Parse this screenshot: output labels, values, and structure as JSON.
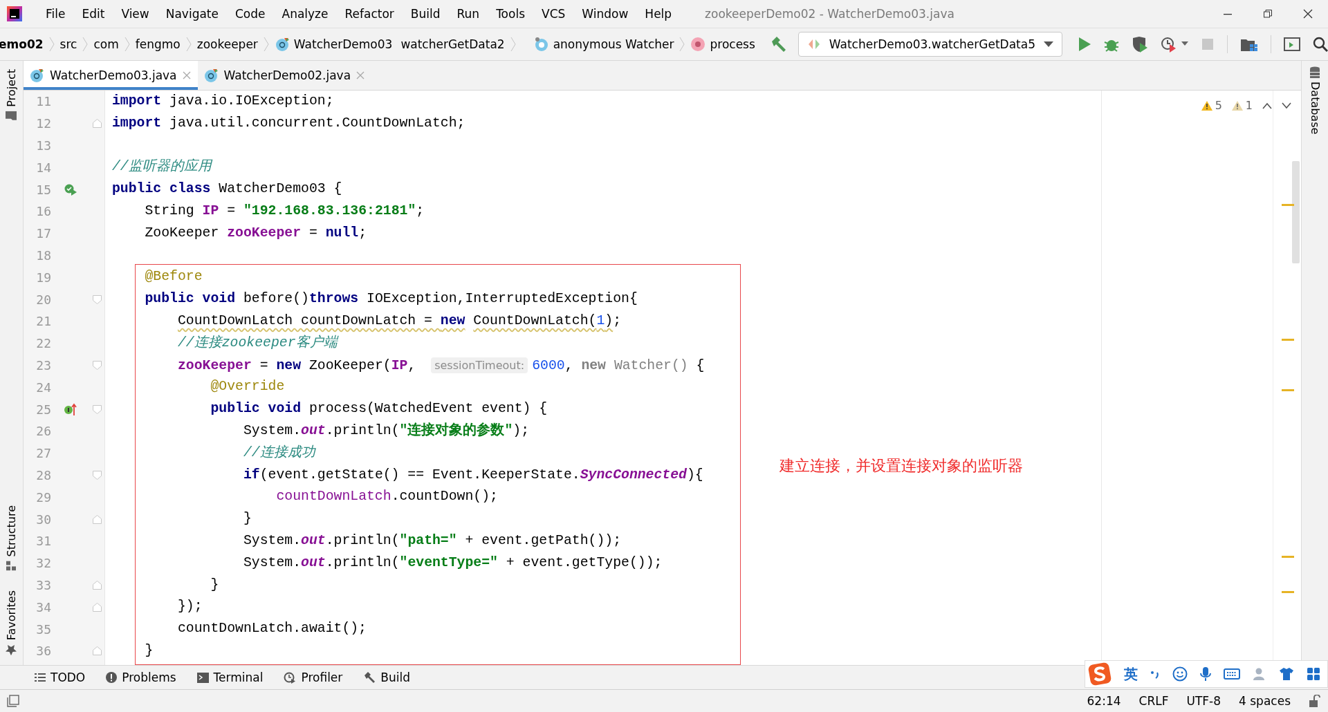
{
  "window": {
    "title": "zookeeperDemo02 - WatcherDemo03.java"
  },
  "menu": [
    "File",
    "Edit",
    "View",
    "Navigate",
    "Code",
    "Analyze",
    "Refactor",
    "Build",
    "Run",
    "Tools",
    "VCS",
    "Window",
    "Help"
  ],
  "breadcrumbs": [
    {
      "kind": "project",
      "label": "emo02"
    },
    {
      "kind": "folder",
      "label": "src"
    },
    {
      "kind": "folder",
      "label": "com"
    },
    {
      "kind": "folder",
      "label": "fengmo"
    },
    {
      "kind": "folder",
      "label": "zookeeper"
    },
    {
      "kind": "class",
      "label": "WatcherDemo03"
    },
    {
      "kind": "plain",
      "label": "watcherGetData2"
    },
    {
      "kind": "anonymous",
      "label": "anonymous Watcher"
    },
    {
      "kind": "method",
      "label": "process"
    }
  ],
  "run_config": {
    "label": "WatcherDemo03.watcherGetData5"
  },
  "tabs": [
    {
      "label": "WatcherDemo03.java",
      "selected": true
    },
    {
      "label": "WatcherDemo02.java",
      "selected": false
    }
  ],
  "side_tabs_left": [
    {
      "label": "Project",
      "kind": "project"
    },
    {
      "label": "Structure",
      "kind": "structure"
    },
    {
      "label": "Favorites",
      "kind": "favorites"
    }
  ],
  "side_tabs_right": [
    {
      "label": "Database"
    }
  ],
  "inspections": [
    {
      "kind": "warning",
      "count": "5"
    },
    {
      "kind": "weak",
      "count": "1"
    }
  ],
  "code_lines": [
    {
      "number": "11",
      "tokens": [
        {
          "kind": "kw",
          "text": "import"
        },
        {
          "kind": "plain",
          "text": " java.io.IOException;"
        }
      ]
    },
    {
      "number": "12",
      "fold": {
        "kind": "end"
      },
      "tokens": [
        {
          "kind": "kw",
          "text": "import"
        },
        {
          "kind": "plain",
          "text": " java.util.concurrent.CountDownLatch;"
        }
      ]
    },
    {
      "number": "13"
    },
    {
      "number": "14",
      "tokens": [
        {
          "kind": "comment",
          "text": "//监听器的应用"
        }
      ]
    },
    {
      "number": "15",
      "gutter_icon": {
        "kind": "run"
      },
      "tokens": [
        {
          "kind": "kw",
          "text": "public class"
        },
        {
          "kind": "plain",
          "text": " WatcherDemo03 {"
        }
      ]
    },
    {
      "number": "16",
      "tokens": [
        {
          "kind": "plain",
          "text": "    String "
        },
        {
          "kind": "field",
          "text": "IP"
        },
        {
          "kind": "plain",
          "text": " = "
        },
        {
          "kind": "str",
          "text": "\"192.168.83.136:2181\""
        },
        {
          "kind": "plain",
          "text": ";"
        }
      ]
    },
    {
      "number": "17",
      "tokens": [
        {
          "kind": "plain",
          "text": "    ZooKeeper "
        },
        {
          "kind": "field",
          "text": "zooKeeper"
        },
        {
          "kind": "plain",
          "text": " = "
        },
        {
          "kind": "kw",
          "text": "null"
        },
        {
          "kind": "plain",
          "text": ";"
        }
      ]
    },
    {
      "number": "18"
    },
    {
      "number": "19",
      "tokens": [
        {
          "kind": "annotation",
          "text": "    @Before"
        }
      ]
    },
    {
      "number": "20",
      "fold": {
        "kind": "start"
      },
      "tokens": [
        {
          "kind": "kw",
          "text": "    public void"
        },
        {
          "kind": "plain",
          "text": " before()"
        },
        {
          "kind": "kw",
          "text": "throws"
        },
        {
          "kind": "plain",
          "text": " IOException,InterruptedException{"
        }
      ]
    },
    {
      "number": "21",
      "tokens": [
        {
          "kind": "warn",
          "text": "        CountDownLatch countDownLatch = "
        },
        {
          "kind": "kwwarn",
          "text": "new"
        },
        {
          "kind": "warn",
          "text": " CountDownLatch("
        },
        {
          "kind": "numwarn",
          "text": "1"
        },
        {
          "kind": "warn",
          "text": ")"
        },
        {
          "kind": "plain",
          "text": ";"
        }
      ]
    },
    {
      "number": "22",
      "tokens": [
        {
          "kind": "comment",
          "text": "        //连接zookeeper客户端"
        }
      ]
    },
    {
      "number": "23",
      "fold": {
        "kind": "start"
      },
      "tokens": [
        {
          "kind": "field",
          "text": "        zooKeeper"
        },
        {
          "kind": "plain",
          "text": " = "
        },
        {
          "kind": "kw",
          "text": "new"
        },
        {
          "kind": "plain",
          "text": " ZooKeeper("
        },
        {
          "kind": "field",
          "text": "IP"
        },
        {
          "kind": "plain",
          "text": ", "
        },
        {
          "kind": "hint",
          "text": "sessionTimeout:"
        },
        {
          "kind": "num",
          "text": "6000"
        },
        {
          "kind": "plain",
          "text": ", "
        },
        {
          "kind": "dimkw",
          "text": "new"
        },
        {
          "kind": "dim",
          "text": " Watcher()"
        },
        {
          "kind": "plain",
          "text": " {"
        }
      ]
    },
    {
      "number": "24",
      "tokens": [
        {
          "kind": "annotation",
          "text": "            @Override"
        }
      ]
    },
    {
      "number": "25",
      "gutter_icon": {
        "kind": "implements"
      },
      "fold": {
        "kind": "start"
      },
      "tokens": [
        {
          "kind": "kw",
          "text": "            public void"
        },
        {
          "kind": "plain",
          "text": " process(WatchedEvent event) {"
        }
      ]
    },
    {
      "number": "26",
      "tokens": [
        {
          "kind": "plain",
          "text": "                System."
        },
        {
          "kind": "static",
          "text": "out"
        },
        {
          "kind": "plain",
          "text": ".println("
        },
        {
          "kind": "str",
          "text": "\"连接对象的参数\""
        },
        {
          "kind": "plain",
          "text": ");"
        }
      ]
    },
    {
      "number": "27",
      "tokens": [
        {
          "kind": "comment",
          "text": "                //连接成功"
        }
      ]
    },
    {
      "number": "28",
      "fold": {
        "kind": "start"
      },
      "tokens": [
        {
          "kind": "kw",
          "text": "                if"
        },
        {
          "kind": "plain",
          "text": "(event.getState() == Event.KeeperState."
        },
        {
          "kind": "static",
          "text": "SyncConnected"
        },
        {
          "kind": "plain",
          "text": "){"
        }
      ]
    },
    {
      "number": "29",
      "tokens": [
        {
          "kind": "fieldplain",
          "text": "                    countDownLatch"
        },
        {
          "kind": "plain",
          "text": ".countDown();"
        }
      ]
    },
    {
      "number": "30",
      "fold": {
        "kind": "end"
      },
      "tokens": [
        {
          "kind": "plain",
          "text": "                }"
        }
      ]
    },
    {
      "number": "31",
      "tokens": [
        {
          "kind": "plain",
          "text": "                System."
        },
        {
          "kind": "static",
          "text": "out"
        },
        {
          "kind": "plain",
          "text": ".println("
        },
        {
          "kind": "str",
          "text": "\"path=\""
        },
        {
          "kind": "plain",
          "text": " + event.getPath());"
        }
      ]
    },
    {
      "number": "32",
      "tokens": [
        {
          "kind": "plain",
          "text": "                System."
        },
        {
          "kind": "static",
          "text": "out"
        },
        {
          "kind": "plain",
          "text": ".println("
        },
        {
          "kind": "str",
          "text": "\"eventType=\""
        },
        {
          "kind": "plain",
          "text": " + event.getType());"
        }
      ]
    },
    {
      "number": "33",
      "fold": {
        "kind": "end"
      },
      "tokens": [
        {
          "kind": "plain",
          "text": "            }"
        }
      ]
    },
    {
      "number": "34",
      "fold": {
        "kind": "end"
      },
      "tokens": [
        {
          "kind": "plain",
          "text": "        });"
        }
      ]
    },
    {
      "number": "35",
      "tokens": [
        {
          "kind": "plain",
          "text": "        countDownLatch.await();"
        }
      ]
    },
    {
      "number": "36",
      "fold": {
        "kind": "end"
      },
      "tokens": [
        {
          "kind": "plain",
          "text": "    }"
        }
      ]
    }
  ],
  "annotation": {
    "text": "建立连接，并设置连接对象的监听器"
  },
  "tool_windows": [
    {
      "kind": "todo",
      "label": "TODO"
    },
    {
      "kind": "problems",
      "label": "Problems"
    },
    {
      "kind": "terminal",
      "label": "Terminal"
    },
    {
      "kind": "profiler",
      "label": "Profiler"
    },
    {
      "kind": "build",
      "label": "Build"
    }
  ],
  "ime_toolbar": {
    "mode": "英"
  },
  "status_bar": [
    "62:14",
    "CRLF",
    "UTF-8",
    "4 spaces"
  ]
}
